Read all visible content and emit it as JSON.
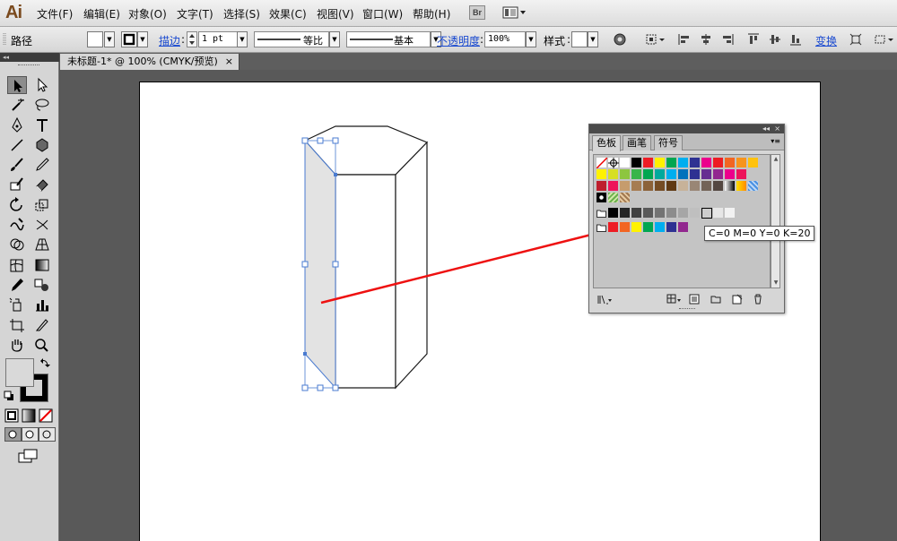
{
  "app": {
    "logo": "Ai",
    "accent": "#7a4a1e"
  },
  "menu": [
    "文件(F)",
    "编辑(E)",
    "对象(O)",
    "文字(T)",
    "选择(S)",
    "效果(C)",
    "视图(V)",
    "窗口(W)",
    "帮助(H)"
  ],
  "menu_extras": {
    "bridge_label": "Br"
  },
  "control_bar": {
    "object_type": "路径",
    "stroke_label": "描边",
    "stroke_weight": "1 pt",
    "profile_label": "等比",
    "brush_label": "基本",
    "opacity_label": "不透明度",
    "opacity_value": "100%",
    "style_label": "样式",
    "transform_label": "变换"
  },
  "document": {
    "tab_title": "未标题-1* @ 100% (CMYK/预览)",
    "close": "×"
  },
  "tools_panel": {
    "collapse": "◂◂",
    "fill_color": "#d9d9d9",
    "stroke_color": "#000000"
  },
  "swatches_panel": {
    "tabs": [
      "色板",
      "画笔",
      "符号"
    ],
    "collapse": "◂◂",
    "close": "×",
    "menu": "▾≡",
    "rows": [
      [
        "none",
        "registration",
        "#ffffff",
        "#000000",
        "#ee1c25",
        "#fff200",
        "#00a651",
        "#00aeef",
        "#2e3192",
        "#ec008c",
        "#ed1c24",
        "#f26522",
        "#f7941d",
        "#ffc20e"
      ],
      [
        "#fff200",
        "#d7df23",
        "#8dc63f",
        "#39b54a",
        "#00a651",
        "#00a99d",
        "#00aeef",
        "#0072bc",
        "#2e3192",
        "#662d91",
        "#92278f",
        "#ec008c",
        "#ed145b"
      ],
      [
        "#be1e2d",
        "#ed145b",
        "#c69c6d",
        "#a67c52",
        "#8c6239",
        "#754c24",
        "#603913",
        "#c7b299",
        "#998675",
        "#736357",
        "#534741",
        "gradient-bw",
        "gradient-orange",
        "gradient-blue"
      ],
      [
        "pattern-1",
        "pattern-2",
        "pattern-3"
      ],
      [
        "folder",
        "#000000",
        "#262626",
        "#404040",
        "#595959",
        "#737373",
        "#8c8c8c",
        "#a6a6a6",
        "#bfbfbf",
        "#cccccc",
        "#e6e6e6",
        "#f2f2f2"
      ],
      [
        "folder",
        "#ed1c24",
        "#f26522",
        "#fff200",
        "#00a651",
        "#00aeef",
        "#2e3192",
        "#92278f"
      ]
    ],
    "selected": {
      "row": 4,
      "col": 9
    }
  },
  "tooltip": {
    "text": "C=0 M=0 Y=0 K=20"
  },
  "colors": {
    "selection": "#4a7bd0",
    "arrow": "#ee1111",
    "face_fill": "#e3e3e3"
  }
}
